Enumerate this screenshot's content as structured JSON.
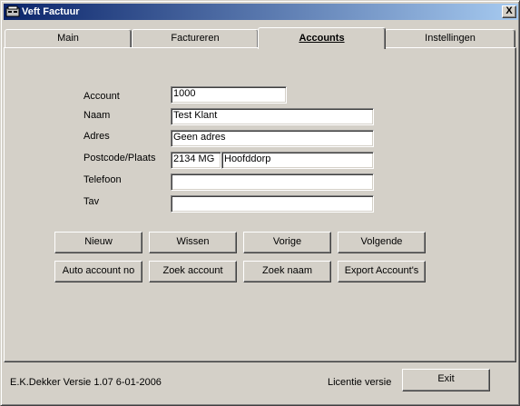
{
  "window": {
    "title": "Veft Factuur",
    "close_glyph": "X"
  },
  "tabs": [
    {
      "label": "Main"
    },
    {
      "label": "Factureren"
    },
    {
      "label": "Accounts"
    },
    {
      "label": "Instellingen"
    }
  ],
  "form": {
    "account": {
      "label": "Account",
      "value": "1000"
    },
    "naam": {
      "label": "Naam",
      "value": "Test Klant"
    },
    "adres": {
      "label": "Adres",
      "value": "Geen adres"
    },
    "postcode_plaats": {
      "label": "Postcode/Plaats",
      "postcode": "2134 MG",
      "plaats": "Hoofddorp"
    },
    "telefoon": {
      "label": "Telefoon",
      "value": ""
    },
    "tav": {
      "label": "Tav",
      "value": ""
    }
  },
  "buttons": {
    "nieuw": "Nieuw",
    "wissen": "Wissen",
    "vorige": "Vorige",
    "volgende": "Volgende",
    "auto_account_no": "Auto account no",
    "zoek_account": "Zoek account",
    "zoek_naam": "Zoek naam",
    "export_accounts": "Export Account's"
  },
  "footer": {
    "author_version": "E.K.Dekker  Versie 1.07  6-01-2006",
    "licence": "Licentie versie",
    "exit_label": "Exit"
  }
}
